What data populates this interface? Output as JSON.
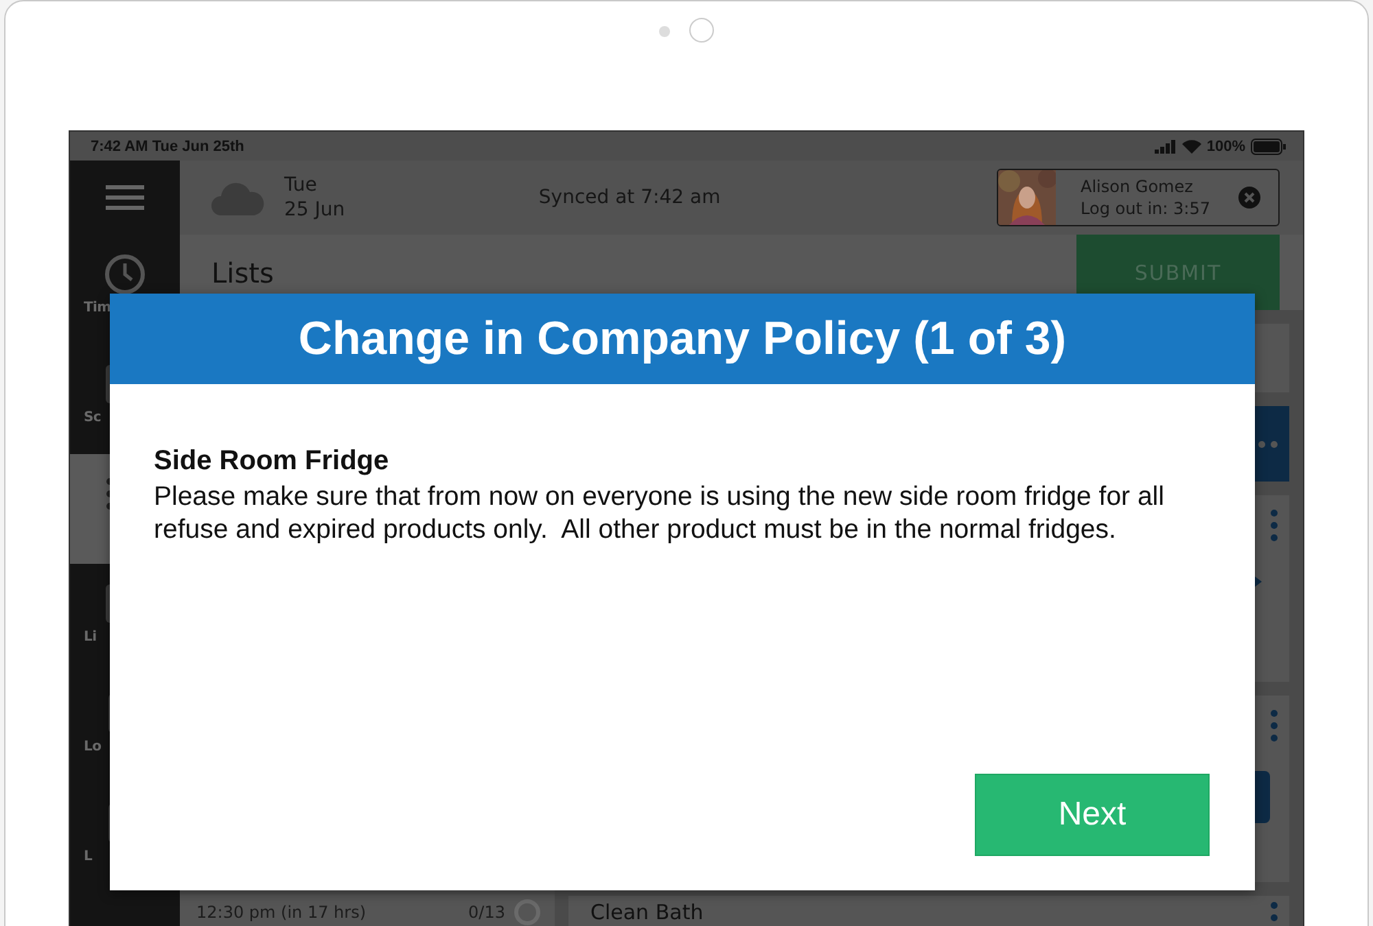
{
  "status_bar": {
    "time": "7:42 AM Tue Jun 25th",
    "battery": "100%"
  },
  "sidebar": {
    "items": [
      {
        "kind": "clock",
        "label": "Tim",
        "selected": false
      },
      {
        "kind": "tablet",
        "label": "Sc",
        "selected": false
      },
      {
        "kind": "list",
        "selected": true
      },
      {
        "kind": "tablet",
        "label": "Li",
        "selected": false
      },
      {
        "kind": "bookmark",
        "label": "Lo",
        "selected": false
      },
      {
        "kind": "bookmark",
        "label": "L",
        "selected": false
      }
    ]
  },
  "header": {
    "day": "Tue",
    "date": "25 Jun",
    "sync": "Synced at 7:42 am",
    "user": {
      "name": "Alison Gomez",
      "logout": "Log out in: 3:57"
    }
  },
  "page": {
    "title": "Lists",
    "submit": "SUBMIT"
  },
  "list_panel": {
    "rows": [
      {
        "time": "12:30 pm (in 17 hrs)",
        "count": "0/13"
      }
    ]
  },
  "tasks": [
    {
      "title": "Clean Bath"
    }
  ],
  "modal": {
    "title": "Change in Company Policy (1 of 3)",
    "heading": "Side Room Fridge",
    "body": "Please make sure that from now on everyone is using the new side room fridge for all refuse and expired products only.  All other product must be in the normal fridges.",
    "button": "Next"
  }
}
